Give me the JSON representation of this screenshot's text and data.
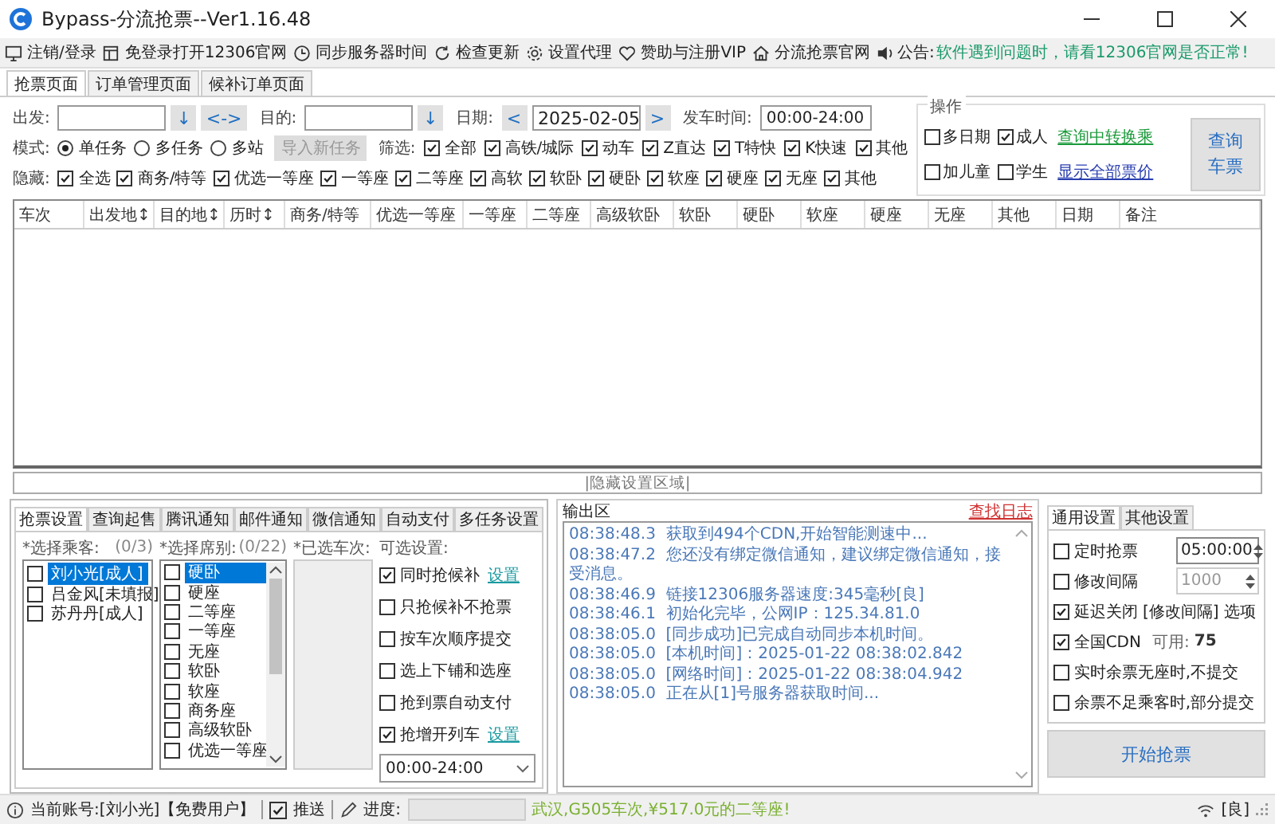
{
  "window": {
    "title": "Bypass-分流抢票--Ver1.16.48"
  },
  "toolbar": [
    {
      "label": "注销/登录"
    },
    {
      "label": "免登录打开12306官网"
    },
    {
      "label": "同步服务器时间"
    },
    {
      "label": "检查更新"
    },
    {
      "label": "设置代理"
    },
    {
      "label": "赞助与注册VIP"
    },
    {
      "label": "分流抢票官网"
    }
  ],
  "notice": {
    "label": "公告:",
    "text": "软件遇到问题时，请看12306官网是否正常!"
  },
  "page_tabs": [
    {
      "label": "抢票页面",
      "selected": true
    },
    {
      "label": "订单管理页面",
      "selected": false
    },
    {
      "label": "候补订单页面",
      "selected": false
    }
  ],
  "search": {
    "from": {
      "label": "出发:",
      "dropdown": "↓"
    },
    "swap_button": "<->",
    "to": {
      "label": "目的:",
      "dropdown": "↓"
    },
    "date": {
      "label": "日期:",
      "prev": "<",
      "value": "2025-02-05",
      "next": ">"
    },
    "depart_time": {
      "label": "发车时间:",
      "value": "00:00-24:00"
    }
  },
  "mode": {
    "label": "模式:",
    "options": [
      {
        "label": "单任务",
        "selected": true
      },
      {
        "label": "多任务",
        "selected": false
      },
      {
        "label": "多站",
        "selected": false
      }
    ],
    "import_button": {
      "label": "导入新任务",
      "disabled": true
    }
  },
  "filter": {
    "label": "筛选:",
    "items": [
      {
        "label": "全部",
        "checked": true
      },
      {
        "label": "高铁/城际",
        "checked": true
      },
      {
        "label": "动车",
        "checked": true
      },
      {
        "label": "Z直达",
        "checked": true
      },
      {
        "label": "T特快",
        "checked": true
      },
      {
        "label": "K快速",
        "checked": true
      },
      {
        "label": "其他",
        "checked": true
      }
    ]
  },
  "hide": {
    "label": "隐藏:",
    "items": [
      {
        "label": "全选",
        "checked": true
      },
      {
        "label": "商务/特等",
        "checked": true
      },
      {
        "label": "优选一等座",
        "checked": true
      },
      {
        "label": "一等座",
        "checked": true
      },
      {
        "label": "二等座",
        "checked": true
      },
      {
        "label": "高软",
        "checked": true
      },
      {
        "label": "软卧",
        "checked": true
      },
      {
        "label": "硬卧",
        "checked": true
      },
      {
        "label": "软座",
        "checked": true
      },
      {
        "label": "硬座",
        "checked": true
      },
      {
        "label": "无座",
        "checked": true
      },
      {
        "label": "其他",
        "checked": true
      }
    ]
  },
  "operations": {
    "title": "操作",
    "checks": [
      {
        "label": "多日期",
        "checked": false
      },
      {
        "label": "成人",
        "checked": true
      },
      {
        "label": "加儿童",
        "checked": false
      },
      {
        "label": "学生",
        "checked": false
      }
    ],
    "links": [
      {
        "label": "查询中转换乘",
        "color": "#1a9a3a"
      },
      {
        "label": "显示全部票价",
        "color": "#2a3fb0"
      }
    ],
    "query_button": "查询车票"
  },
  "table": {
    "columns": [
      "车次",
      "出发地↕",
      "目的地↕",
      "历时↕",
      "商务/特等",
      "优选一等座",
      "一等座",
      "二等座",
      "高级软卧",
      "软卧",
      "硬卧",
      "软座",
      "硬座",
      "无座",
      "其他",
      "日期",
      "备注"
    ]
  },
  "toggle_bar": "|隐藏设置区域|",
  "settings_tabs": [
    {
      "label": "抢票设置",
      "selected": true
    },
    {
      "label": "查询起售",
      "selected": false
    },
    {
      "label": "腾讯通知",
      "selected": false
    },
    {
      "label": "邮件通知",
      "selected": false
    },
    {
      "label": "微信通知",
      "selected": false
    },
    {
      "label": "自动支付",
      "selected": false
    },
    {
      "label": "多任务设置",
      "selected": false
    }
  ],
  "passengers": {
    "label": "*选择乘客:",
    "count": "(0/3)",
    "items": [
      {
        "label": "刘小光[成人]",
        "checked": false,
        "selected": true
      },
      {
        "label": "吕金风[未填报]",
        "checked": false,
        "selected": false
      },
      {
        "label": "苏丹丹[成人]",
        "checked": false,
        "selected": false
      }
    ]
  },
  "seats": {
    "label": "*选择席别:",
    "count": "(0/22)",
    "items": [
      {
        "label": "硬卧",
        "checked": false,
        "selected": true
      },
      {
        "label": "硬座",
        "checked": false,
        "selected": false
      },
      {
        "label": "二等座",
        "checked": false,
        "selected": false
      },
      {
        "label": "一等座",
        "checked": false,
        "selected": false
      },
      {
        "label": "无座",
        "checked": false,
        "selected": false
      },
      {
        "label": "软卧",
        "checked": false,
        "selected": false
      },
      {
        "label": "软座",
        "checked": false,
        "selected": false
      },
      {
        "label": "商务座",
        "checked": false,
        "selected": false
      },
      {
        "label": "高级软卧",
        "checked": false,
        "selected": false
      },
      {
        "label": "优选一等座",
        "checked": false,
        "selected": false
      }
    ]
  },
  "trains": {
    "label": "*已选车次:"
  },
  "options": {
    "label": "可选设置:",
    "items": [
      {
        "label": "同时抢候补",
        "checked": true,
        "link": "设置"
      },
      {
        "label": "只抢候补不抢票",
        "checked": false
      },
      {
        "label": "按车次顺序提交",
        "checked": false
      },
      {
        "label": "选上下铺和选座",
        "checked": false
      },
      {
        "label": "抢到票自动支付",
        "checked": false
      },
      {
        "label": "抢增开列车",
        "checked": true,
        "link": "设置"
      }
    ],
    "time_range": "00:00-24:00"
  },
  "output": {
    "title": "输出区",
    "log_link": "查找日志",
    "lines": [
      {
        "time": "08:38:48.3",
        "text": "获取到494个CDN,开始智能测速中..."
      },
      {
        "time": "08:38:47.2",
        "text": "您还没有绑定微信通知，建议绑定微信通知，接受消息。"
      },
      {
        "time": "08:38:46.9",
        "text": "链接12306服务器速度:345毫秒[良]"
      },
      {
        "time": "08:38:46.1",
        "text": "初始化完毕，公网IP：125.34.81.0"
      },
      {
        "time": "08:38:05.0",
        "text": "[同步成功]已完成自动同步本机时间。"
      },
      {
        "time": "08:38:05.0",
        "text": "[本机时间]：2025-01-22 08:38:02.842"
      },
      {
        "time": "08:38:05.0",
        "text": "[网络时间]：2025-01-22 08:38:04.942"
      },
      {
        "time": "08:38:05.0",
        "text": "正在从[1]号服务器获取时间..."
      }
    ]
  },
  "general_tabs": [
    {
      "label": "通用设置",
      "selected": true
    },
    {
      "label": "其他设置",
      "selected": false
    }
  ],
  "general": {
    "items": [
      {
        "kind": "spinner",
        "label": "定时抢票",
        "checked": false,
        "value": "05:00:00",
        "disabled": false
      },
      {
        "kind": "spinner",
        "label": "修改间隔",
        "checked": false,
        "value": "1000",
        "disabled": true
      },
      {
        "kind": "check",
        "label": "延迟关闭 [修改间隔] 选项",
        "checked": true
      },
      {
        "kind": "cdn",
        "label": "全国CDN",
        "checked": true,
        "available_label": "可用:",
        "available": "75"
      },
      {
        "kind": "check",
        "label": "实时余票无座时,不提交",
        "checked": false
      },
      {
        "kind": "check",
        "label": "余票不足乘客时,部分提交",
        "checked": false
      }
    ],
    "start_button": "开始抢票"
  },
  "status_bar": {
    "account": "当前账号:[刘小光]【免费用户】",
    "push": {
      "label": "推送",
      "checked": true
    },
    "progress_label": "进度:",
    "progress": {
      "level": 0
    },
    "message": "武汉,G505车次,¥517.0元的二等座!",
    "network": "[良]"
  }
}
